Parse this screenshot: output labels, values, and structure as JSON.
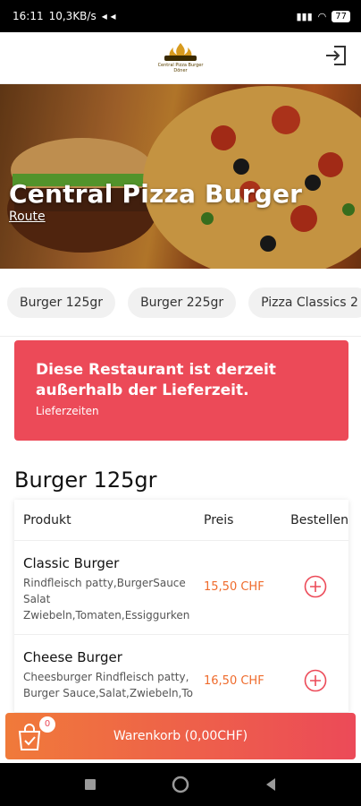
{
  "status_bar": {
    "time": "16:11",
    "network_speed": "10,3KB/s",
    "battery": "77"
  },
  "header": {
    "logo_text": "Central Pizza Burger Döner"
  },
  "hero": {
    "title": "Central Pizza Burger",
    "route_link": "Route"
  },
  "categories": [
    "Burger 125gr",
    "Burger 225gr",
    "Pizza Classics 2"
  ],
  "alert": {
    "title": "Diese Restaurant ist derzeit außerhalb der Lieferzeit.",
    "link": "Lieferzeiten"
  },
  "section": {
    "title": "Burger 125gr",
    "columns": {
      "product": "Produkt",
      "price": "Preis",
      "order": "Bestellen"
    },
    "products": [
      {
        "name": "Classic Burger",
        "description": "Rindfleisch patty,BurgerSauce Salat Zwiebeln,Tomaten,Essiggurken",
        "price": "15,50 CHF"
      },
      {
        "name": "Cheese Burger",
        "description": "Cheesburger Rindfleisch patty, Burger Sauce,Salat,Zwiebeln,To",
        "price": "16,50 CHF"
      }
    ]
  },
  "cart": {
    "count": "0",
    "label": "Warenkorb (0,00CHF)"
  },
  "colors": {
    "accent_red": "#ec4a58",
    "accent_orange": "#ef6b2c"
  }
}
